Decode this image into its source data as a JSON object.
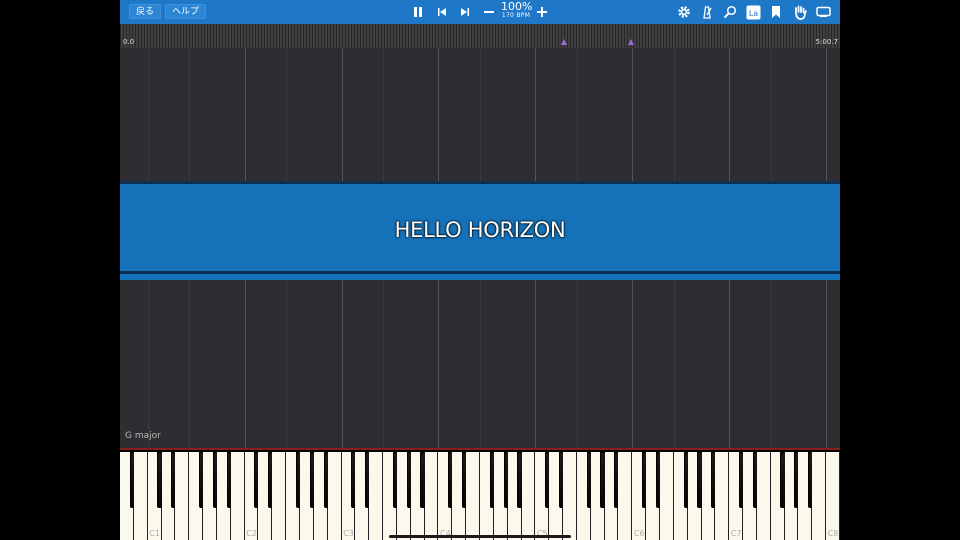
{
  "toolbar": {
    "back_label": "戻る",
    "help_label": "ヘルプ",
    "tempo_percent": "100%",
    "tempo_bpm": "170 BPM",
    "icons": [
      "pause-icon",
      "skip-back-icon",
      "skip-forward-icon",
      "minus-icon",
      "plus-icon",
      "gear-icon",
      "metronome-icon",
      "magnifier-icon",
      "label-icon",
      "bookmark-icon",
      "hand-icon",
      "keyboard-icon"
    ],
    "label_icon_text": "La"
  },
  "timeline": {
    "start": "0.0",
    "end": "5:00.7"
  },
  "song": {
    "title": "HELLO HORIZON",
    "key_signature": "G major"
  },
  "keyboard": {
    "octave_labels": [
      "C1",
      "C2",
      "C3",
      "C4",
      "C5",
      "C6",
      "C7",
      "C8"
    ]
  },
  "colors": {
    "toolbar": "#1f77c8",
    "banner": "#1672b8",
    "marker": "#9b6cd8",
    "background": "#2e2d31"
  }
}
